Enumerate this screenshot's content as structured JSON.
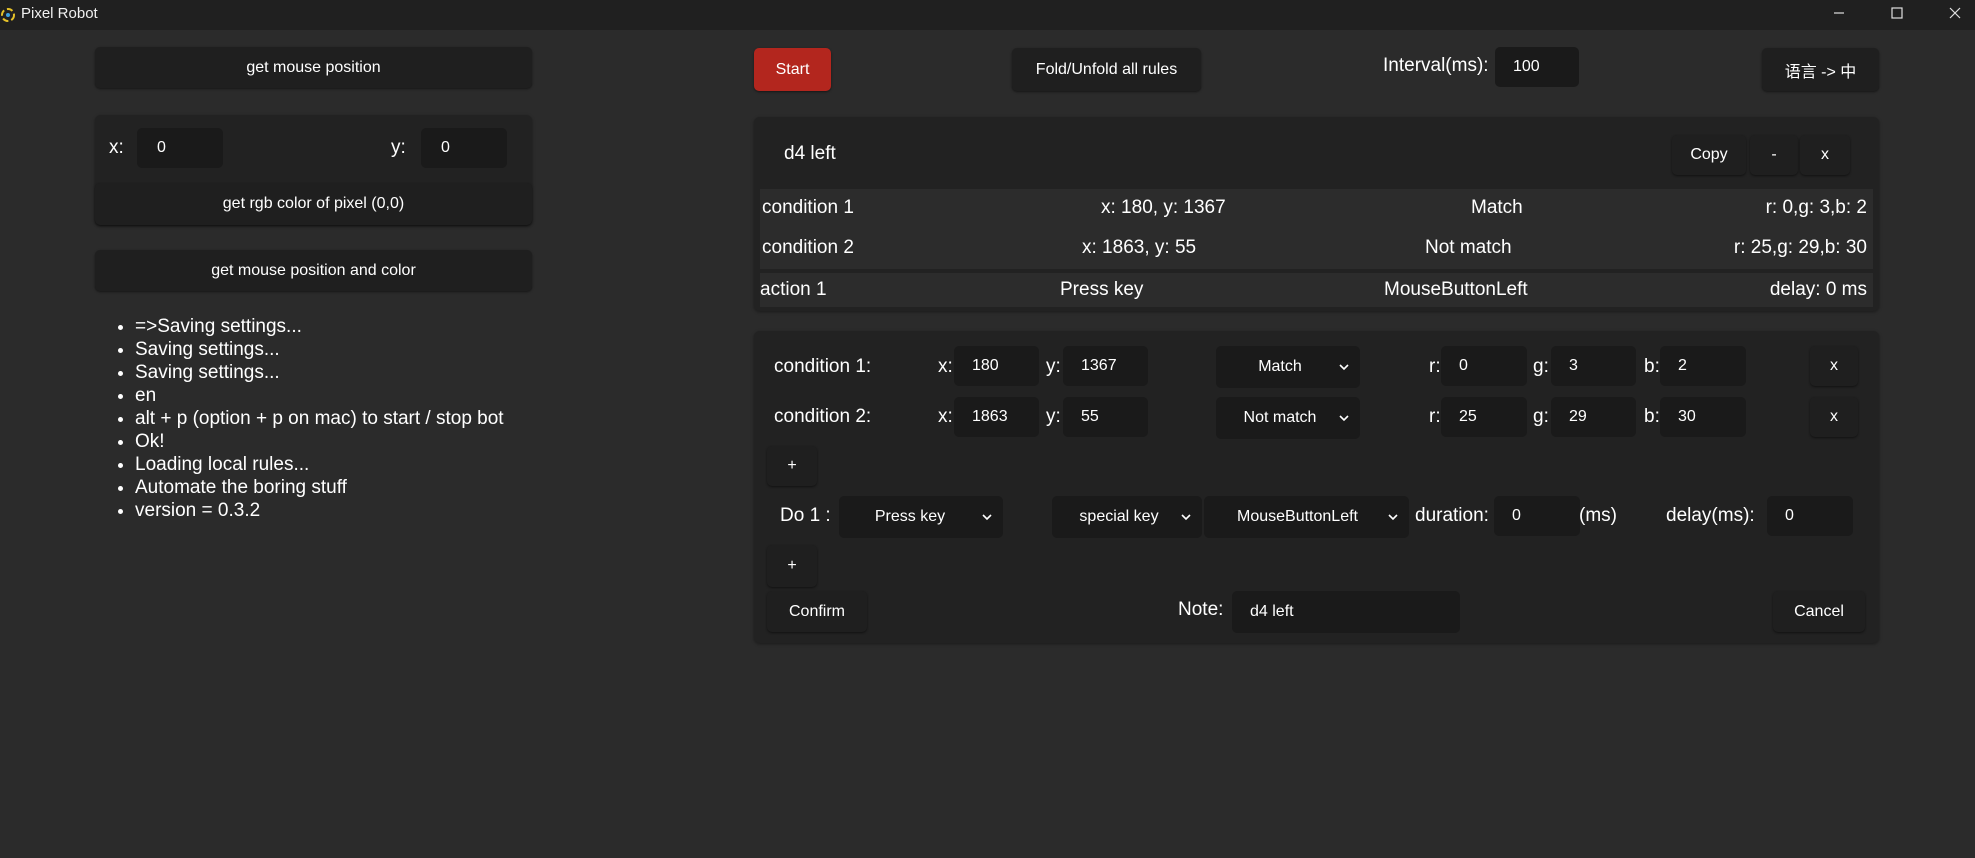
{
  "window": {
    "title": "Pixel Robot"
  },
  "left": {
    "get_mouse_position": "get mouse position",
    "x_label": "x:",
    "x_value": "0",
    "y_label": "y:",
    "y_value": "0",
    "get_rgb": "get rgb color of pixel (0,0)",
    "get_mouse_pos_color": "get mouse position and color",
    "log": [
      "=>Saving settings...",
      "Saving settings...",
      "Saving settings...",
      "en",
      "alt + p (option + p on mac) to start / stop bot",
      "Ok!",
      "Loading local rules...",
      "Automate the boring stuff",
      "version = 0.3.2"
    ]
  },
  "toolbar": {
    "start": "Start",
    "fold": "Fold/Unfold all rules",
    "interval_label": "Interval(ms):",
    "interval_value": "100",
    "language": "语言 -> 中",
    "start_color": "#b3261e"
  },
  "rule_summary": {
    "name": "d4 left",
    "copy": "Copy",
    "minus": "-",
    "close": "x",
    "conditions": [
      {
        "label": "condition 1",
        "pos": "x: 180, y: 1367",
        "match": "Match",
        "rgb": "r: 0,g: 3,b: 2"
      },
      {
        "label": "condition 2",
        "pos": "x: 1863, y: 55",
        "match": "Not match",
        "rgb": "r: 25,g: 29,b: 30"
      }
    ],
    "action": {
      "label": "action 1",
      "type": "Press key",
      "key": "MouseButtonLeft",
      "delay": "delay: 0 ms"
    }
  },
  "editor": {
    "conditions": [
      {
        "label": "condition 1:",
        "x": "180",
        "y": "1367",
        "match": "Match",
        "r": "0",
        "g": "3",
        "b": "2"
      },
      {
        "label": "condition 2:",
        "x": "1863",
        "y": "55",
        "match": "Not match",
        "r": "25",
        "g": "29",
        "b": "30"
      }
    ],
    "x_label": "x:",
    "y_label": "y:",
    "r_label": "r:",
    "g_label": "g:",
    "b_label": "b:",
    "remove": "x",
    "add": "+",
    "do_label": "Do 1 :",
    "action_type": "Press key",
    "key_kind": "special key",
    "key": "MouseButtonLeft",
    "duration_label": "duration:",
    "duration_value": "0",
    "ms_label": "(ms)",
    "delay_label": "delay(ms):",
    "delay_value": "0",
    "confirm": "Confirm",
    "note_label": "Note:",
    "note_value": "d4 left",
    "cancel": "Cancel"
  }
}
